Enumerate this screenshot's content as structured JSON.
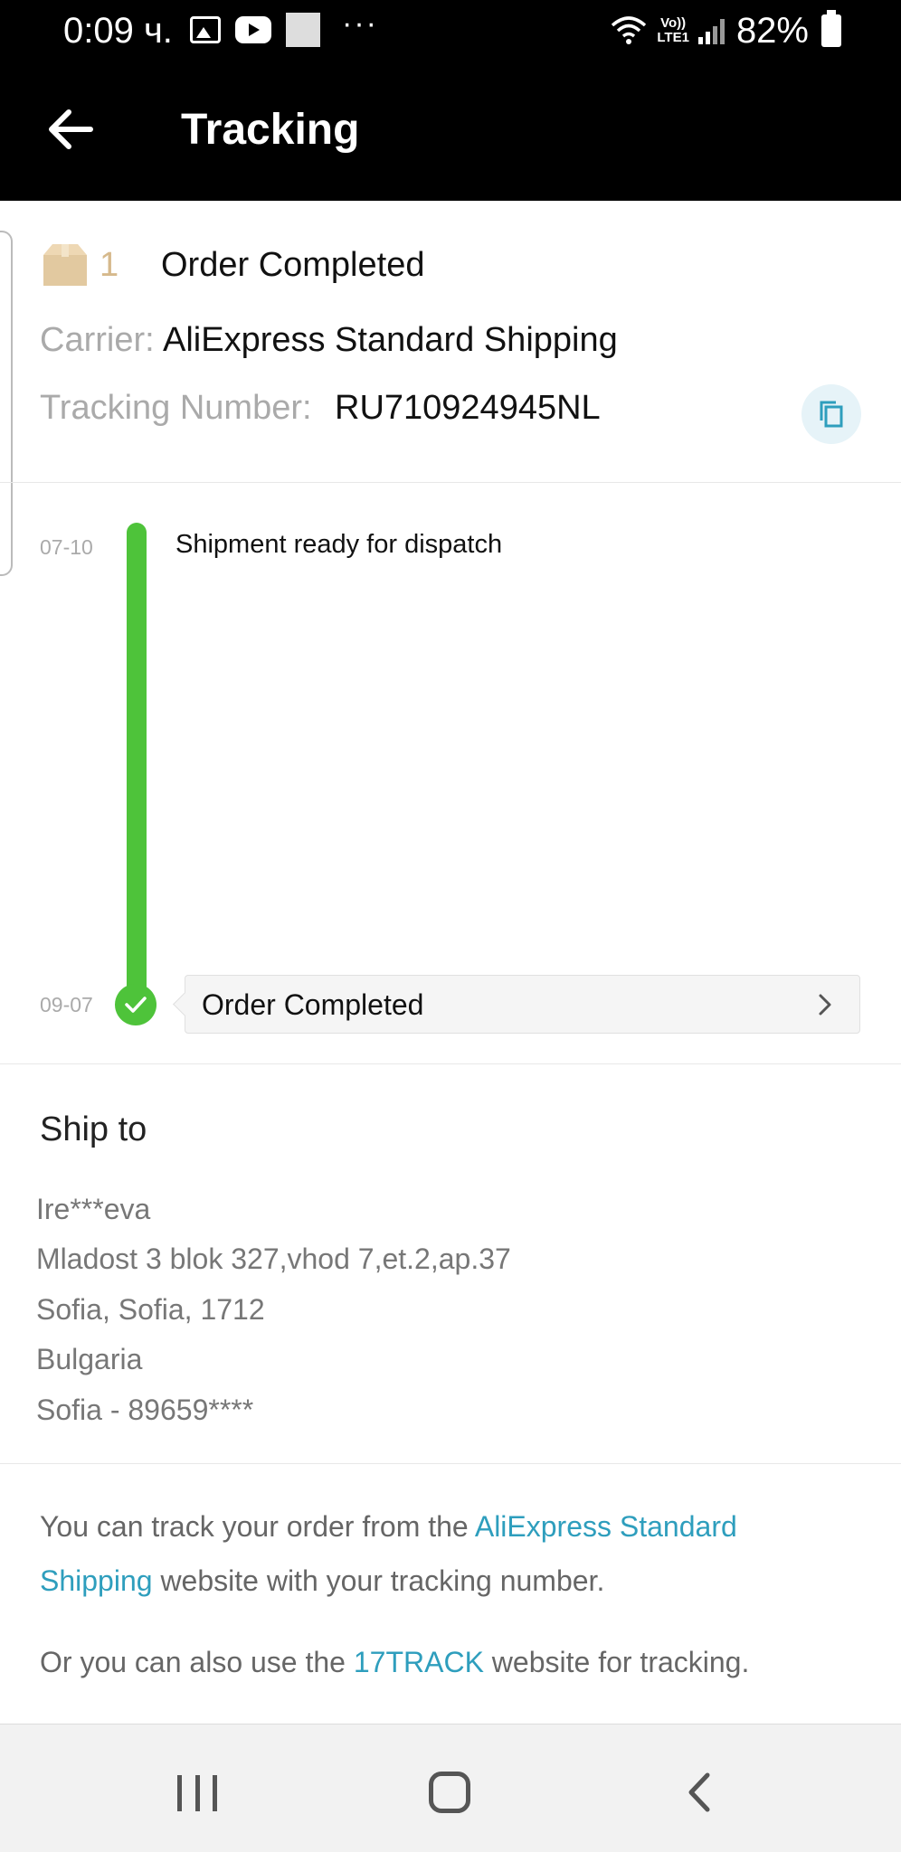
{
  "status_bar": {
    "time": "0:09 ч.",
    "network_label_top": "Vo))",
    "network_label_bottom": "LTE1",
    "battery": "82%",
    "left_icons": [
      "image-icon",
      "youtube-icon",
      "square-icon",
      "more-dots-icon"
    ],
    "more_dots": "···"
  },
  "header": {
    "title": "Tracking",
    "back_icon": "arrow-left-icon"
  },
  "order": {
    "count": "1",
    "status": "Order Completed",
    "carrier_label": "Carrier:",
    "carrier_value": "AliExpress Standard Shipping",
    "tracking_label": "Tracking Number:",
    "tracking_value": "RU710924945NL",
    "copy_icon": "copy-icon",
    "box_icon": "package-box-icon",
    "box_color": "#e2c9a0"
  },
  "timeline": {
    "accent_color": "#4ec33a",
    "events": [
      {
        "date": "07-10",
        "label": "Shipment ready for dispatch"
      },
      {
        "date": "09-07",
        "label": "Order Completed"
      }
    ]
  },
  "ship_to": {
    "title": "Ship to",
    "lines": [
      "Ire***eva",
      "Mladost 3 blok 327,vhod 7,et.2,ap.37",
      "Sofia, Sofia, 1712",
      "Bulgaria",
      "Sofia - 89659****"
    ]
  },
  "info": {
    "line1_prefix": "You can track your order from the ",
    "line1_link_a": "AliExpress Standard",
    "line2_link_b": "Shipping",
    "line2_suffix": " website with your tracking number.",
    "line3_prefix": "Or you can also use the ",
    "line3_link": "17TRACK",
    "line3_suffix": " website for tracking.",
    "link_color": "#2e9ebd"
  },
  "nav_bar": {
    "buttons": [
      "recent-apps-icon",
      "home-icon",
      "back-icon"
    ]
  }
}
